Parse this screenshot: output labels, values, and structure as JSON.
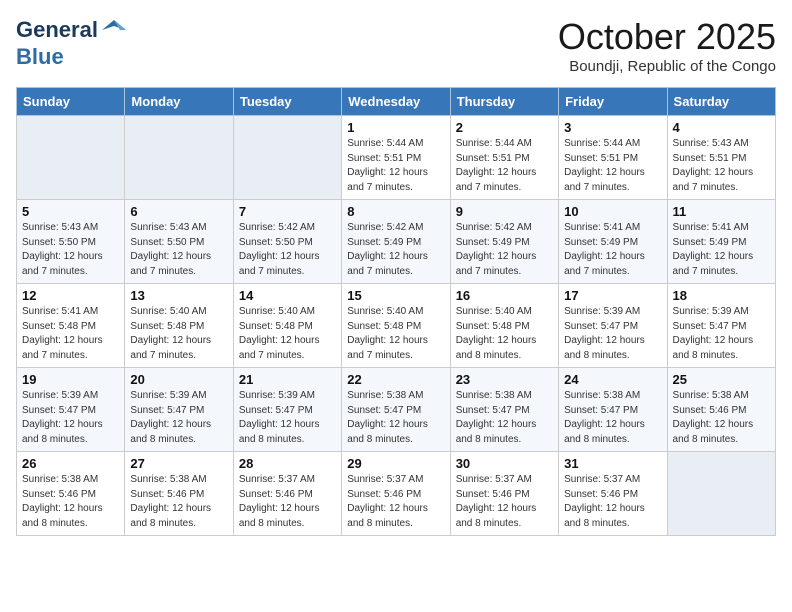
{
  "header": {
    "logo_general": "General",
    "logo_blue": "Blue",
    "month": "October 2025",
    "location": "Boundji, Republic of the Congo"
  },
  "weekdays": [
    "Sunday",
    "Monday",
    "Tuesday",
    "Wednesday",
    "Thursday",
    "Friday",
    "Saturday"
  ],
  "weeks": [
    [
      {
        "day": "",
        "info": ""
      },
      {
        "day": "",
        "info": ""
      },
      {
        "day": "",
        "info": ""
      },
      {
        "day": "1",
        "info": "Sunrise: 5:44 AM\nSunset: 5:51 PM\nDaylight: 12 hours\nand 7 minutes."
      },
      {
        "day": "2",
        "info": "Sunrise: 5:44 AM\nSunset: 5:51 PM\nDaylight: 12 hours\nand 7 minutes."
      },
      {
        "day": "3",
        "info": "Sunrise: 5:44 AM\nSunset: 5:51 PM\nDaylight: 12 hours\nand 7 minutes."
      },
      {
        "day": "4",
        "info": "Sunrise: 5:43 AM\nSunset: 5:51 PM\nDaylight: 12 hours\nand 7 minutes."
      }
    ],
    [
      {
        "day": "5",
        "info": "Sunrise: 5:43 AM\nSunset: 5:50 PM\nDaylight: 12 hours\nand 7 minutes."
      },
      {
        "day": "6",
        "info": "Sunrise: 5:43 AM\nSunset: 5:50 PM\nDaylight: 12 hours\nand 7 minutes."
      },
      {
        "day": "7",
        "info": "Sunrise: 5:42 AM\nSunset: 5:50 PM\nDaylight: 12 hours\nand 7 minutes."
      },
      {
        "day": "8",
        "info": "Sunrise: 5:42 AM\nSunset: 5:49 PM\nDaylight: 12 hours\nand 7 minutes."
      },
      {
        "day": "9",
        "info": "Sunrise: 5:42 AM\nSunset: 5:49 PM\nDaylight: 12 hours\nand 7 minutes."
      },
      {
        "day": "10",
        "info": "Sunrise: 5:41 AM\nSunset: 5:49 PM\nDaylight: 12 hours\nand 7 minutes."
      },
      {
        "day": "11",
        "info": "Sunrise: 5:41 AM\nSunset: 5:49 PM\nDaylight: 12 hours\nand 7 minutes."
      }
    ],
    [
      {
        "day": "12",
        "info": "Sunrise: 5:41 AM\nSunset: 5:48 PM\nDaylight: 12 hours\nand 7 minutes."
      },
      {
        "day": "13",
        "info": "Sunrise: 5:40 AM\nSunset: 5:48 PM\nDaylight: 12 hours\nand 7 minutes."
      },
      {
        "day": "14",
        "info": "Sunrise: 5:40 AM\nSunset: 5:48 PM\nDaylight: 12 hours\nand 7 minutes."
      },
      {
        "day": "15",
        "info": "Sunrise: 5:40 AM\nSunset: 5:48 PM\nDaylight: 12 hours\nand 7 minutes."
      },
      {
        "day": "16",
        "info": "Sunrise: 5:40 AM\nSunset: 5:48 PM\nDaylight: 12 hours\nand 8 minutes."
      },
      {
        "day": "17",
        "info": "Sunrise: 5:39 AM\nSunset: 5:47 PM\nDaylight: 12 hours\nand 8 minutes."
      },
      {
        "day": "18",
        "info": "Sunrise: 5:39 AM\nSunset: 5:47 PM\nDaylight: 12 hours\nand 8 minutes."
      }
    ],
    [
      {
        "day": "19",
        "info": "Sunrise: 5:39 AM\nSunset: 5:47 PM\nDaylight: 12 hours\nand 8 minutes."
      },
      {
        "day": "20",
        "info": "Sunrise: 5:39 AM\nSunset: 5:47 PM\nDaylight: 12 hours\nand 8 minutes."
      },
      {
        "day": "21",
        "info": "Sunrise: 5:39 AM\nSunset: 5:47 PM\nDaylight: 12 hours\nand 8 minutes."
      },
      {
        "day": "22",
        "info": "Sunrise: 5:38 AM\nSunset: 5:47 PM\nDaylight: 12 hours\nand 8 minutes."
      },
      {
        "day": "23",
        "info": "Sunrise: 5:38 AM\nSunset: 5:47 PM\nDaylight: 12 hours\nand 8 minutes."
      },
      {
        "day": "24",
        "info": "Sunrise: 5:38 AM\nSunset: 5:47 PM\nDaylight: 12 hours\nand 8 minutes."
      },
      {
        "day": "25",
        "info": "Sunrise: 5:38 AM\nSunset: 5:46 PM\nDaylight: 12 hours\nand 8 minutes."
      }
    ],
    [
      {
        "day": "26",
        "info": "Sunrise: 5:38 AM\nSunset: 5:46 PM\nDaylight: 12 hours\nand 8 minutes."
      },
      {
        "day": "27",
        "info": "Sunrise: 5:38 AM\nSunset: 5:46 PM\nDaylight: 12 hours\nand 8 minutes."
      },
      {
        "day": "28",
        "info": "Sunrise: 5:37 AM\nSunset: 5:46 PM\nDaylight: 12 hours\nand 8 minutes."
      },
      {
        "day": "29",
        "info": "Sunrise: 5:37 AM\nSunset: 5:46 PM\nDaylight: 12 hours\nand 8 minutes."
      },
      {
        "day": "30",
        "info": "Sunrise: 5:37 AM\nSunset: 5:46 PM\nDaylight: 12 hours\nand 8 minutes."
      },
      {
        "day": "31",
        "info": "Sunrise: 5:37 AM\nSunset: 5:46 PM\nDaylight: 12 hours\nand 8 minutes."
      },
      {
        "day": "",
        "info": ""
      }
    ]
  ]
}
